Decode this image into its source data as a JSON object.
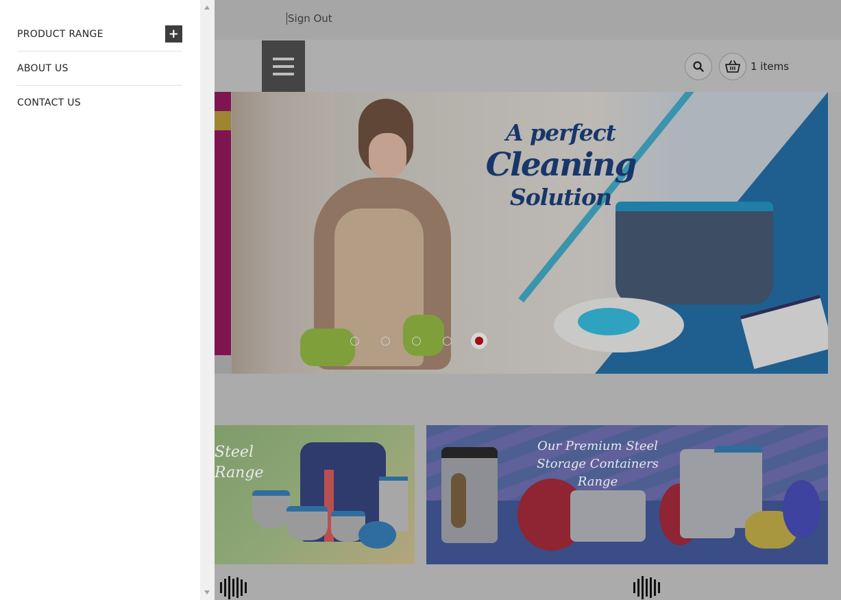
{
  "header": {
    "sign_out": "Sign Out",
    "cart_count": "1 items"
  },
  "drawer": {
    "items": [
      {
        "label": "PRODUCT RANGE",
        "expand_icon": "plus-icon"
      },
      {
        "label": "ABOUT US"
      },
      {
        "label": "CONTACT US"
      }
    ]
  },
  "hero": {
    "headline_line1": "A perfect",
    "headline_line2": "Cleaning",
    "headline_line3": "Solution",
    "slide_count": 5,
    "active_slide": 5
  },
  "tiles": {
    "left_title_line1": "Steel",
    "left_title_line2": "Range",
    "right_title_line1": "Our Premium Steel",
    "right_title_line2": "Storage Containers Range"
  },
  "colors": {
    "drawer_bg": "#ffffff",
    "menu_button": "#444444",
    "active_dot": "#a10c0c",
    "headline": "#17376a"
  }
}
